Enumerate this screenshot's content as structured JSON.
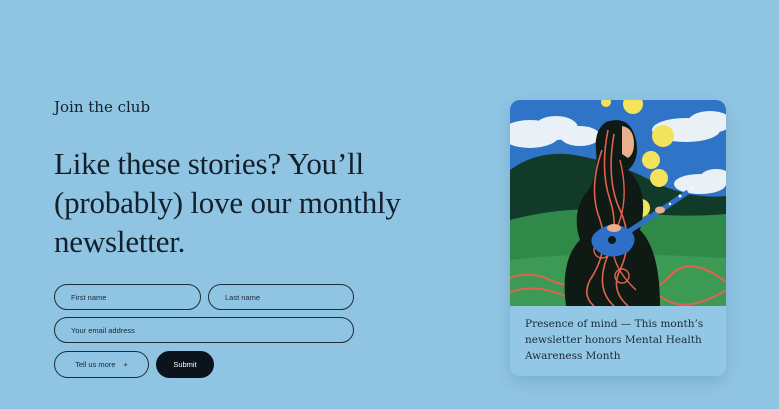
{
  "signup": {
    "eyebrow": "Join the club",
    "headline": "Like these stories? You’ll (probably) love our monthly newsletter.",
    "fields": {
      "first_name_placeholder": "First name",
      "last_name_placeholder": "Last name",
      "email_placeholder": "Your email address"
    },
    "tell_us_more_label": "Tell us more",
    "tell_us_more_icon": "plus-icon",
    "tell_us_more_glyph": "+",
    "submit_label": "Submit"
  },
  "feature_card": {
    "illustration": "woman-playing-ukulele-illustration",
    "caption": "Presence of mind — This month’s newsletter honors Mental Health Awareness Month"
  },
  "colors": {
    "page_background": "#8fc4e2",
    "text": "#13202b",
    "submit_background": "#0b141c",
    "illustration_sky": "#2f74c6",
    "illustration_hill": "#2f8a4a",
    "illustration_moon": "#f3e35a"
  }
}
